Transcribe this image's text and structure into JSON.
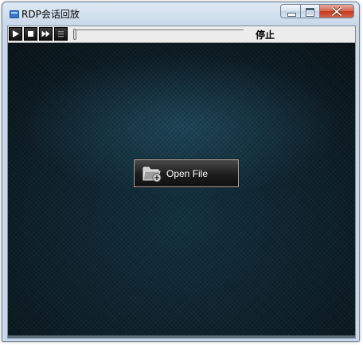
{
  "window": {
    "title": "RDP会话回放",
    "icon": "app-window-icon",
    "controls": [
      "minimize-icon",
      "maximize-icon",
      "close-icon"
    ]
  },
  "toolbar": {
    "buttons": [
      {
        "name": "play",
        "icon": "play-icon"
      },
      {
        "name": "stop",
        "icon": "stop-icon"
      },
      {
        "name": "fast-forward",
        "icon": "fast-forward-icon"
      },
      {
        "name": "list",
        "icon": "list-icon"
      }
    ],
    "progress": 0,
    "status": "停止"
  },
  "main": {
    "open_button": {
      "label": "Open File",
      "icon": "folder-open-icon"
    }
  },
  "colors": {
    "stage_background": "#0e1d26",
    "toolbar_background": "#ececec",
    "button_text": "#ffffff"
  }
}
